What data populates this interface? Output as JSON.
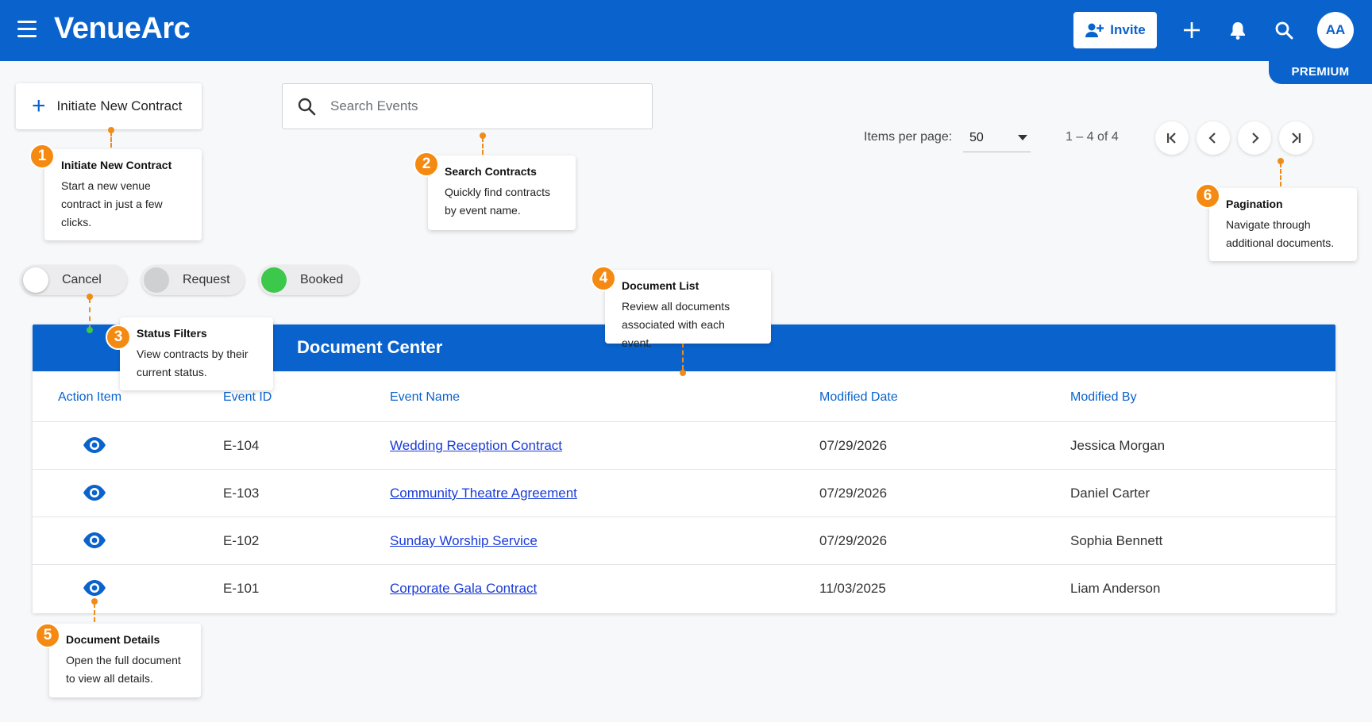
{
  "app": {
    "name": "VenueArc",
    "tier_badge": "PREMIUM"
  },
  "header": {
    "invite_label": "Invite",
    "avatar_initials": "AA",
    "icons": [
      "menu-icon",
      "user-plus-icon",
      "plus-icon",
      "bell-icon",
      "search-icon"
    ]
  },
  "toolbar": {
    "new_contract_label": "Initiate New Contract",
    "search_placeholder": "Search Events"
  },
  "pagination": {
    "items_per_page_label": "Items per page:",
    "items_per_page_value": "50",
    "range_text": "1 – 4 of 4"
  },
  "filters": [
    {
      "label": "Cancel",
      "color": "#ffffff"
    },
    {
      "label": "Request",
      "color": "#cfd0d2"
    },
    {
      "label": "Booked",
      "color": "#3cc84a"
    }
  ],
  "table": {
    "title": "Document Center",
    "columns": [
      "Action Item",
      "Event ID",
      "Event Name",
      "Modified Date",
      "Modified By"
    ],
    "rows": [
      {
        "event_id": "E-104",
        "event_name": "Wedding Reception Contract",
        "modified_date": "07/29/2026",
        "modified_by": "Jessica Morgan"
      },
      {
        "event_id": "E-103",
        "event_name": "Community Theatre Agreement",
        "modified_date": "07/29/2026",
        "modified_by": "Daniel Carter"
      },
      {
        "event_id": "E-102",
        "event_name": "Sunday Worship Service",
        "modified_date": "07/29/2026",
        "modified_by": "Sophia Bennett"
      },
      {
        "event_id": "E-101",
        "event_name": "Corporate Gala Contract",
        "modified_date": "11/03/2025",
        "modified_by": "Liam Anderson"
      }
    ]
  },
  "callouts": [
    {
      "number": "1",
      "title": "Initiate New Contract",
      "desc": [
        "Start a new venue",
        "contract in just a few",
        "clicks."
      ]
    },
    {
      "number": "2",
      "title": "Search Contracts",
      "desc": [
        "Quickly find contracts",
        "by event name."
      ]
    },
    {
      "number": "3",
      "title": "Status Filters",
      "desc": [
        "View contracts by their",
        "current status."
      ]
    },
    {
      "number": "4",
      "title": "Document List",
      "desc": [
        "Review all documents",
        "associated with each event."
      ]
    },
    {
      "number": "5",
      "title": "Document Details",
      "desc": [
        "Open the full document",
        "to view all details."
      ]
    },
    {
      "number": "6",
      "title": "Pagination",
      "desc": [
        "Navigate through",
        "additional documents."
      ]
    }
  ],
  "colors": {
    "brand": "#0a63cd",
    "accent": "#f58a12",
    "link": "#1a3bd8"
  }
}
